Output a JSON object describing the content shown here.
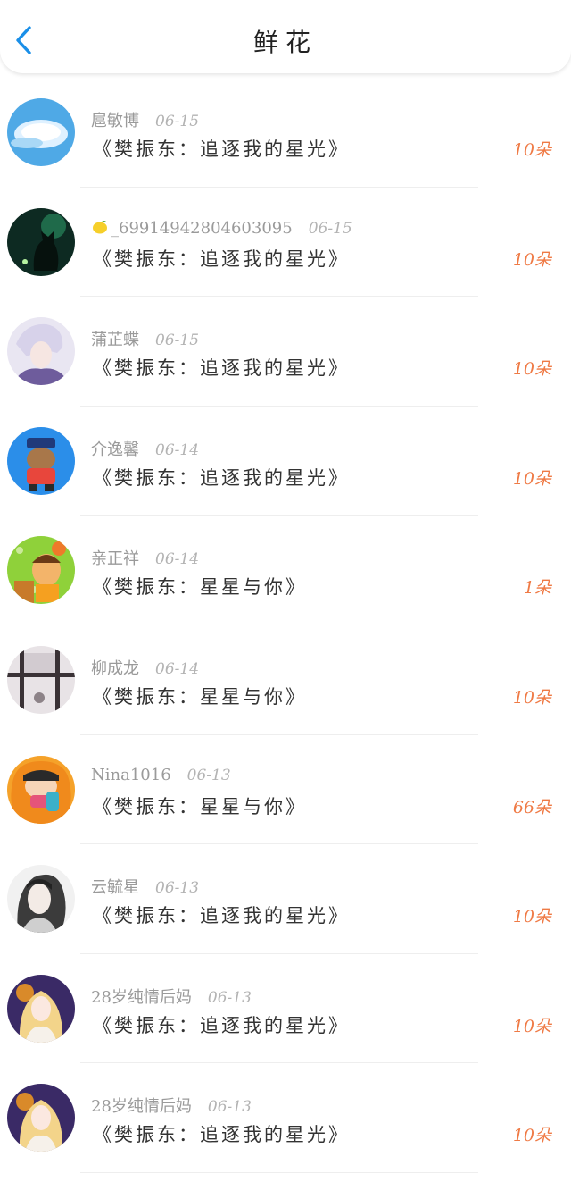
{
  "header": {
    "title": "鲜花"
  },
  "items": [
    {
      "name": "扈敏博",
      "date": "06-15",
      "song": "《樊振东：追逐我的星光》",
      "count": "10朵",
      "avatar": "cloud-avatar"
    },
    {
      "name": "_699149428046030​95",
      "date": "06-15",
      "song": "《樊振东：追逐我的星光》",
      "count": "10朵",
      "avatar": "black-cat-avatar",
      "prefix_icon": "lemon-icon"
    },
    {
      "name": "蒲芷蝶",
      "date": "06-15",
      "song": "《樊振东：追逐我的星光》",
      "count": "10朵",
      "avatar": "anime-boy-avatar"
    },
    {
      "name": "介逸馨",
      "date": "06-14",
      "song": "《樊振东：追逐我的星光》",
      "count": "10朵",
      "avatar": "cartoon-bear-avatar"
    },
    {
      "name": "亲正祥",
      "date": "06-14",
      "song": "《樊振东：星星与你》",
      "count": "1朵",
      "avatar": "cartoon-girl-avatar"
    },
    {
      "name": "柳成龙",
      "date": "06-14",
      "song": "《樊振东：星星与你》",
      "count": "10朵",
      "avatar": "window-avatar"
    },
    {
      "name": "Nina1016",
      "date": "06-13",
      "song": "《樊振东：星星与你》",
      "count": "66朵",
      "avatar": "orange-cartoon-avatar"
    },
    {
      "name": "云毓星",
      "date": "06-13",
      "song": "《樊振东：追逐我的星光》",
      "count": "10朵",
      "avatar": "sketch-girl-avatar"
    },
    {
      "name": "28岁纯情后妈",
      "date": "06-13",
      "song": "《樊振东：追逐我的星光》",
      "count": "10朵",
      "avatar": "princess-avatar"
    },
    {
      "name": "28岁纯情后妈",
      "date": "06-13",
      "song": "《樊振东：追逐我的星光》",
      "count": "10朵",
      "avatar": "princess-avatar"
    }
  ],
  "colors": {
    "accent": "#1a8fe8",
    "count": "#ef7a45",
    "name": "#9a9a9a"
  }
}
